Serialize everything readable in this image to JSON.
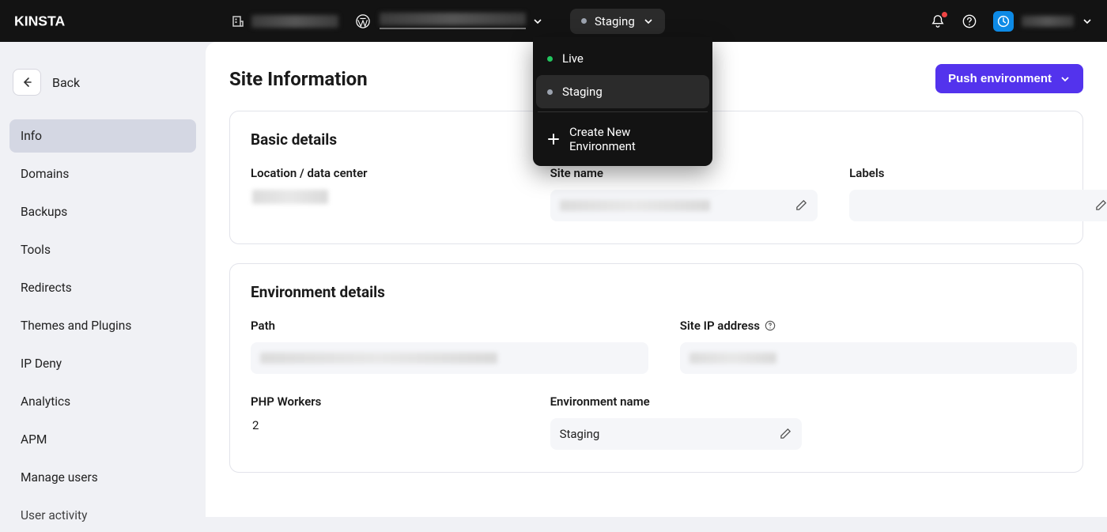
{
  "header": {
    "brand": "KINSTA",
    "env_button_label": "Staging"
  },
  "env_menu": {
    "items": [
      {
        "label": "Live",
        "status": "live"
      },
      {
        "label": "Staging",
        "status": "staging",
        "selected": true
      }
    ],
    "create_label": "Create New Environment"
  },
  "sidebar": {
    "back_label": "Back",
    "items": [
      "Info",
      "Domains",
      "Backups",
      "Tools",
      "Redirects",
      "Themes and Plugins",
      "IP Deny",
      "Analytics",
      "APM",
      "Manage users",
      "User activity"
    ],
    "active_index": 0
  },
  "page": {
    "title": "Site Information",
    "push_button": "Push environment"
  },
  "basic_details": {
    "title": "Basic details",
    "location_label": "Location / data center",
    "site_name_label": "Site name",
    "labels_label": "Labels"
  },
  "environment_details": {
    "title": "Environment details",
    "path_label": "Path",
    "ip_label": "Site IP address",
    "php_workers_label": "PHP Workers",
    "php_workers_value": "2",
    "env_name_label": "Environment name",
    "env_name_value": "Staging"
  }
}
